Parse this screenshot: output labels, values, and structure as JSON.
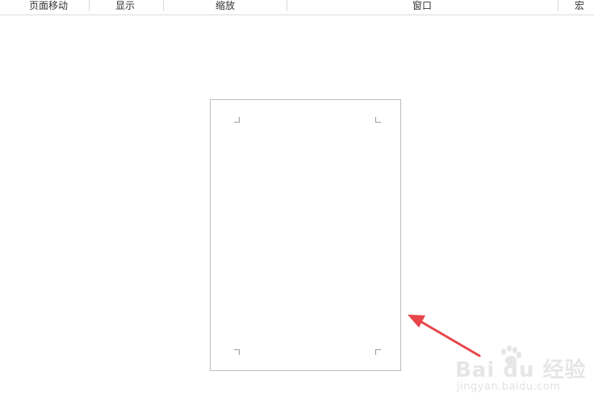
{
  "ribbon": {
    "groups": [
      {
        "label": "页面移动"
      },
      {
        "label": "显示"
      },
      {
        "label": "缩放"
      },
      {
        "label": "窗口"
      },
      {
        "label": "宏"
      }
    ]
  },
  "watermark": {
    "brand": "Bai du 经验",
    "url": "jingyan.baidu.com"
  },
  "colors": {
    "arrow": "#e8464a",
    "page_border": "#bdbdbd",
    "background": "#ffffff"
  }
}
